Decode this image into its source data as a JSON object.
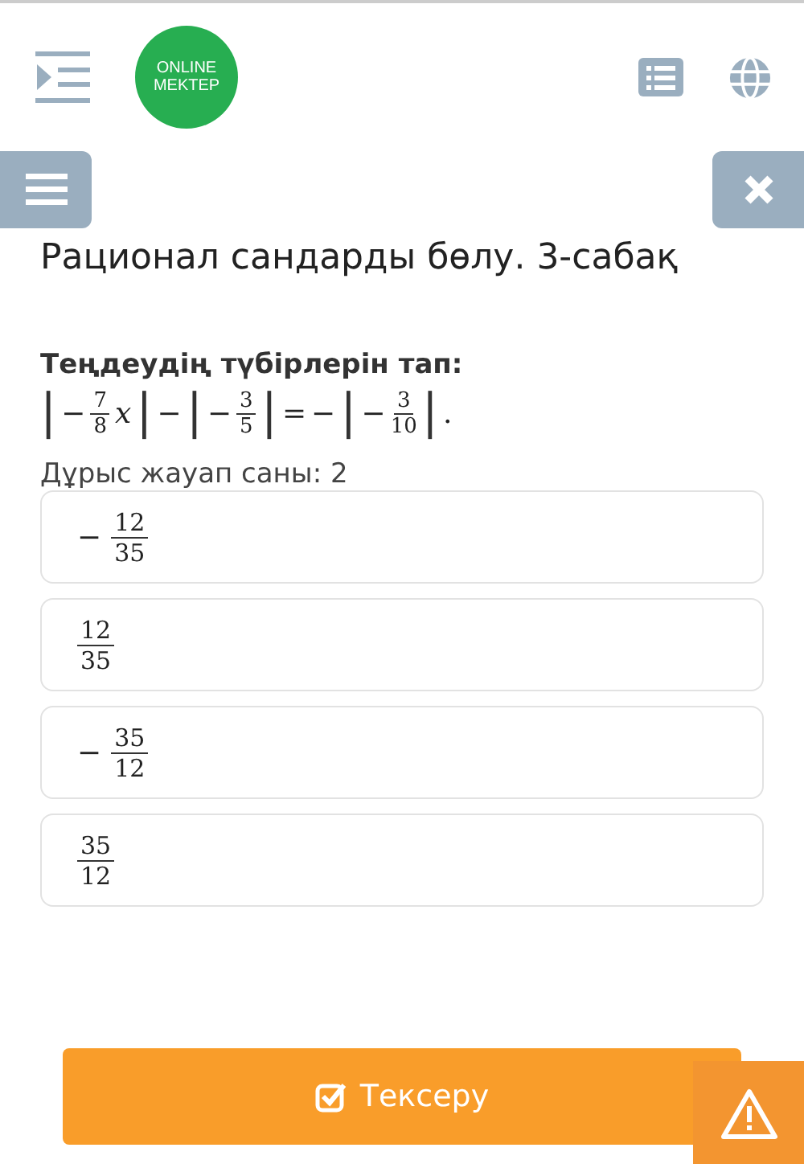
{
  "header": {
    "logo": [
      "ONLINE",
      "MEKTEP"
    ]
  },
  "title": "Рационал сандарды бөлу. 3-сабақ",
  "question": {
    "prompt": "Теңдеудің түбірлерін тап:",
    "equation": [
      {
        "kind": "bar",
        "text": "|"
      },
      {
        "kind": "op",
        "text": "−"
      },
      {
        "kind": "frac",
        "numerator": "7",
        "denominator": "8"
      },
      {
        "kind": "var",
        "text": "x"
      },
      {
        "kind": "bar",
        "text": "|"
      },
      {
        "kind": "op",
        "text": "−"
      },
      {
        "kind": "bar",
        "text": "|"
      },
      {
        "kind": "op",
        "text": "−"
      },
      {
        "kind": "frac",
        "numerator": "3",
        "denominator": "5"
      },
      {
        "kind": "bar",
        "text": "|"
      },
      {
        "kind": "op",
        "text": "="
      },
      {
        "kind": "op",
        "text": "−"
      },
      {
        "kind": "bar",
        "text": "|"
      },
      {
        "kind": "op",
        "text": "−"
      },
      {
        "kind": "frac",
        "numerator": "3",
        "denominator": "10"
      },
      {
        "kind": "bar",
        "text": "|"
      },
      {
        "kind": "op",
        "text": "."
      }
    ],
    "answer_count": "Дұрыс жауап саны: 2"
  },
  "options": [
    {
      "sign": "−",
      "numerator": "12",
      "denominator": "35"
    },
    {
      "numerator": "12",
      "denominator": "35"
    },
    {
      "sign": "−",
      "numerator": "35",
      "denominator": "12"
    },
    {
      "numerator": "35",
      "denominator": "12"
    }
  ],
  "check_button": "Тексеру"
}
